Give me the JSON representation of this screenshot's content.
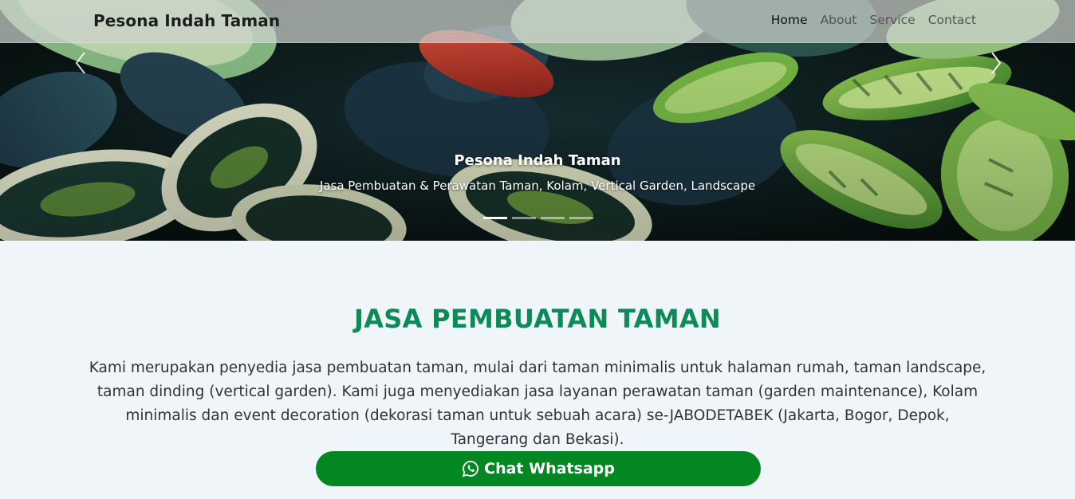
{
  "navbar": {
    "brand": "Pesona Indah Taman",
    "links": [
      {
        "label": "Home",
        "active": true
      },
      {
        "label": "About",
        "active": false
      },
      {
        "label": "Service",
        "active": false
      },
      {
        "label": "Contact",
        "active": false
      }
    ]
  },
  "hero": {
    "title": "Pesona Indah Taman",
    "subtitle": "Jasa Pembuatan & Perawatan Taman, Kolam, Vertical Garden, Landscape",
    "slide_count": 4,
    "active_slide": 1,
    "prev_icon": "chevron-left-icon",
    "next_icon": "chevron-right-icon"
  },
  "section": {
    "title": "JASA PEMBUATAN TAMAN",
    "description": "Kami merupakan penyedia jasa pembuatan taman, mulai dari taman minimalis untuk halaman rumah, taman landscape, taman dinding (vertical garden). Kami juga menyediakan jasa layanan perawatan taman (garden maintenance), Kolam minimalis dan event decoration (dekorasi taman untuk sebuah acara) se-JABODETABEK (Jakarta, Bogor, Depok, Tangerang dan Bekasi).",
    "button_label": "Chat Whatsapp",
    "button_icon": "whatsapp-icon"
  },
  "colors": {
    "accent_title": "#0c8a57",
    "button_bg": "#028723",
    "page_bg": "#f0f5f9"
  }
}
